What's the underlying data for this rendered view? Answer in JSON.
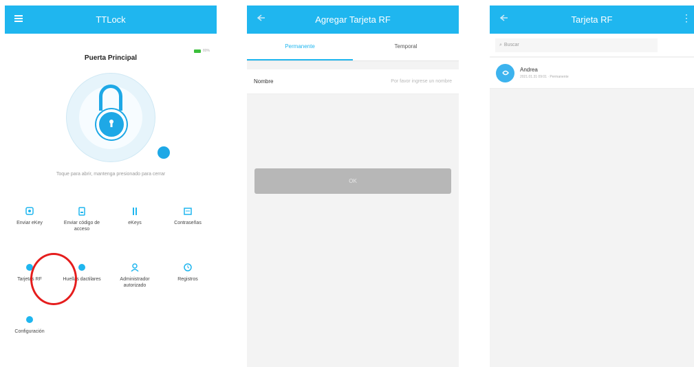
{
  "home": {
    "title": "TTLock",
    "lock_name": "Puerta Principal",
    "battery_text": "80%",
    "hint": "Toque para abrir, mantenga presionado para cerrar",
    "menu": [
      {
        "label": "Enviar eKey",
        "icon": "send-ekey-icon"
      },
      {
        "label": "Enviar código de acceso",
        "icon": "passcode-icon"
      },
      {
        "label": "eKeys",
        "icon": "ekeys-icon"
      },
      {
        "label": "Contraseñas",
        "icon": "passwords-icon"
      },
      {
        "label": "Tarjetas RF",
        "icon": "rf-card-icon"
      },
      {
        "label": "Huellas dactilares",
        "icon": "fingerprint-icon"
      },
      {
        "label": "Administrador autorizado",
        "icon": "admin-icon"
      },
      {
        "label": "Registros",
        "icon": "records-icon"
      },
      {
        "label": "Configuración",
        "icon": "settings-icon"
      }
    ],
    "accent": "#1fb6ef",
    "highlight": "#e51d1d"
  },
  "add_card": {
    "title": "Agregar Tarjeta RF",
    "tabs": [
      "Permanente",
      "Temporal"
    ],
    "name_label": "Nombre",
    "name_placeholder": "Por favor ingrese un nombre",
    "ok_label": "OK"
  },
  "card_list": {
    "title": "Tarjeta RF",
    "search_placeholder": "Buscar",
    "items": [
      {
        "name": "Andrea",
        "meta": "2021.01.31 09:01 · Permanente"
      }
    ]
  }
}
